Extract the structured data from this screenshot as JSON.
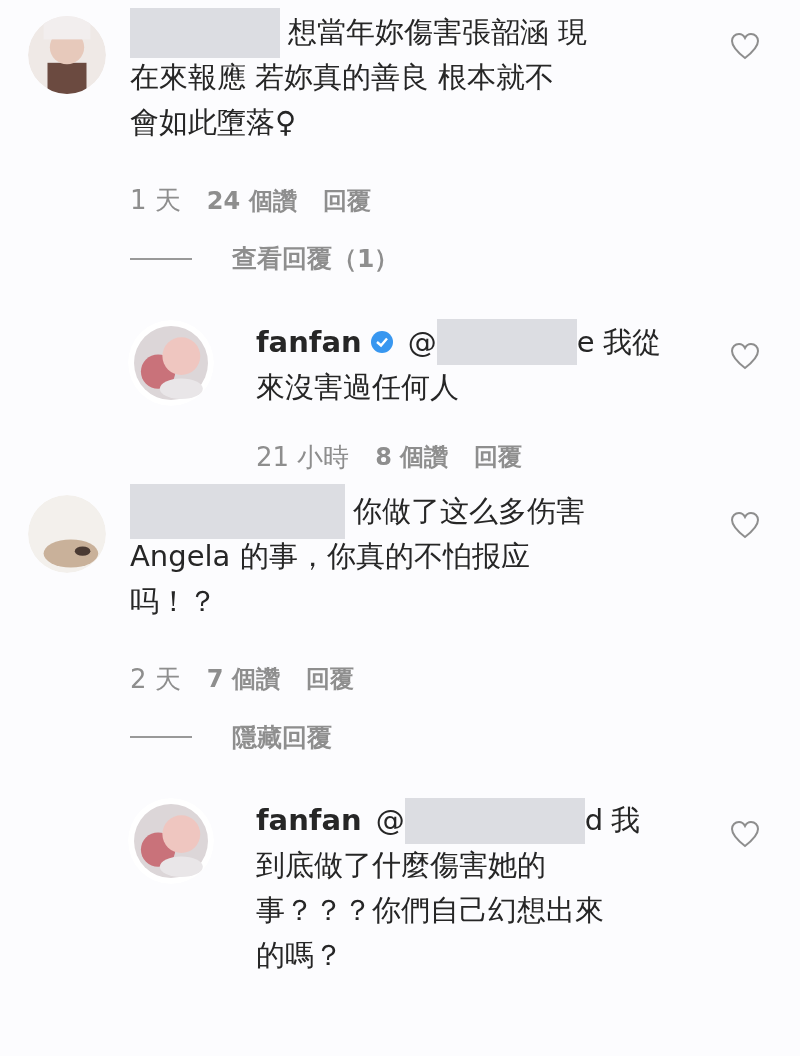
{
  "comments": [
    {
      "lines": [
        "想當年妳傷害張韶涵 現",
        "在來報應 若妳真的善良 根本就不",
        "會如此墮落♀"
      ],
      "time": "1 天",
      "likes": "24 個讚",
      "reply_label": "回覆",
      "replies_toggle": "查看回覆（1）",
      "replies": [
        {
          "username": "fanfan",
          "verified": true,
          "mention": "@",
          "mention_tail": "e",
          "lines": [
            "我從",
            "來沒害過任何人"
          ],
          "time": "21 小時",
          "likes": "8 個讚",
          "reply_label": "回覆"
        }
      ]
    },
    {
      "lines": [
        "你做了这么多伤害",
        "Angela 的事，你真的不怕报应",
        "吗！？"
      ],
      "time": "2 天",
      "likes": "7 個讚",
      "reply_label": "回覆",
      "replies_toggle": "隱藏回覆",
      "replies": [
        {
          "username": "fanfan",
          "verified": false,
          "mention": "@",
          "mention_tail": "d",
          "lines": [
            "我",
            "到底做了什麼傷害她的",
            "事？？？你們自己幻想出來",
            "的嗎？"
          ]
        }
      ]
    }
  ]
}
